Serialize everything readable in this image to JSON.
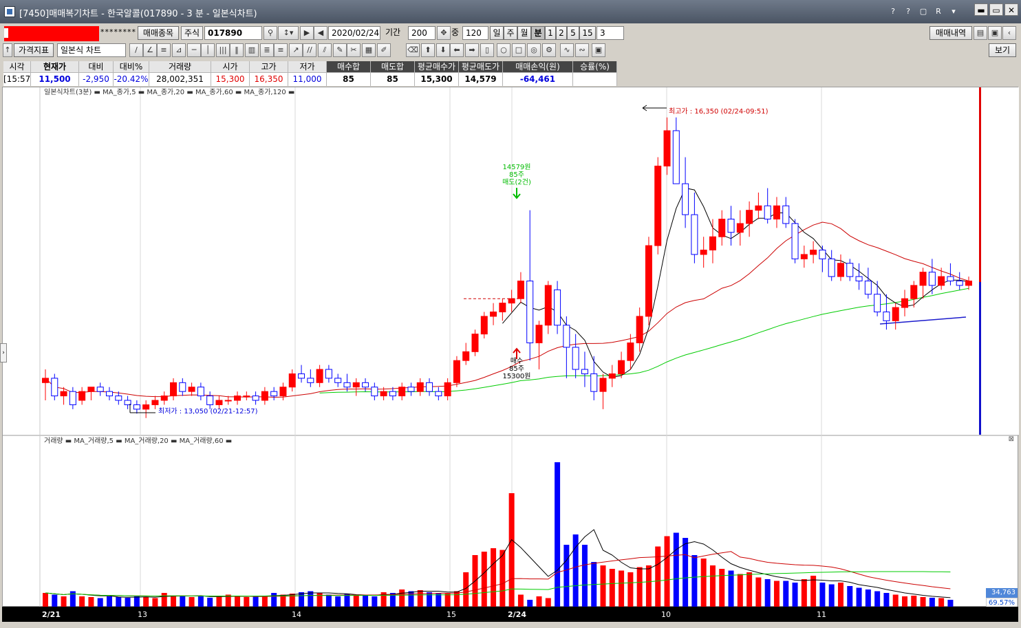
{
  "window": {
    "title": "[7450]매매복기차트 - 한국알콜(017890 - 3 분 - 일본식차트)",
    "icons": [
      "?",
      "?",
      "▢",
      "R",
      "▾"
    ],
    "win_buttons": [
      "▬",
      "▭",
      "✕"
    ]
  },
  "toolbar1": {
    "masked": "********",
    "trade_item_btn": "매매종목",
    "market": "주식",
    "code": "017890",
    "date": "2020/02/24",
    "period_label": "기간",
    "period": "200",
    "mid_label": "중",
    "count": "120",
    "periods": [
      "일",
      "주",
      "월",
      "분",
      "1",
      "2",
      "5",
      "15"
    ],
    "selected_period": "분",
    "interval": "3",
    "history_btn": "매매내역"
  },
  "toolbar2": {
    "indicator_btn": "가격지표",
    "chart_type": "일본식 차트",
    "view_btn": "보기"
  },
  "quote": {
    "headers": [
      "시각",
      "현재가",
      "대비",
      "대비%",
      "거래량",
      "시가",
      "고가",
      "저가",
      "매수합",
      "매도합",
      "평균매수가",
      "평균매도가",
      "매매손익(원)",
      "승률(%)"
    ],
    "values": [
      "[15:57]",
      "11,500",
      "-2,950",
      "-20.42%",
      "28,002,351",
      "15,300",
      "16,350",
      "11,000",
      "85",
      "85",
      "15,300",
      "14,579",
      "-64,461",
      ""
    ]
  },
  "chart": {
    "price_legend": "일본식차트(3분) ▬ MA_종가,5 ▬ MA_종가,20 ▬ MA_종가,60 ▬ MA_종가,120 ▬",
    "volume_legend": "거래량 ▬ MA_거래량,5 ▬ MA_거래량,20 ▬ MA_거래량,60 ▬",
    "high_label": "최고가 : 16,350 (02/24-09:51)",
    "low_label": "최저가 : 13,050 (02/21-12:57)",
    "sell_line1": "14579원",
    "sell_line2": "85주",
    "sell_line3": "매도(2건)",
    "buy_line1": "매수",
    "buy_line2": "85주",
    "buy_line3": "15300원",
    "vol_value": "34,763",
    "vol_pct": "69.57%",
    "dates": [
      "2/21",
      "13",
      "14",
      "15",
      "2/24",
      "10",
      "11"
    ]
  },
  "colors": {
    "up": "#ff0000",
    "down": "#0000ff",
    "ma5": "#000000",
    "ma20": "#cc0000",
    "ma60": "#00cc00",
    "ma120": "#1a1acc"
  },
  "chart_data": {
    "type": "candlestick",
    "candles": [
      [
        13350,
        13500,
        13150,
        13400
      ],
      [
        13400,
        13450,
        13150,
        13200
      ],
      [
        13200,
        13300,
        13100,
        13250
      ],
      [
        13250,
        13300,
        13050,
        13100
      ],
      [
        13150,
        13300,
        13100,
        13250
      ],
      [
        13250,
        13300,
        13150,
        13300
      ],
      [
        13300,
        13350,
        13200,
        13250
      ],
      [
        13250,
        13300,
        13150,
        13200
      ],
      [
        13200,
        13250,
        13100,
        13150
      ],
      [
        13150,
        13200,
        13050,
        13100
      ],
      [
        13100,
        13150,
        13000,
        13050
      ],
      [
        13050,
        13150,
        12950,
        13100
      ],
      [
        13100,
        13200,
        13050,
        13150
      ],
      [
        13150,
        13250,
        13100,
        13200
      ],
      [
        13200,
        13400,
        13150,
        13350
      ],
      [
        13350,
        13400,
        13200,
        13250
      ],
      [
        13250,
        13350,
        13200,
        13300
      ],
      [
        13300,
        13350,
        13150,
        13200
      ],
      [
        13200,
        13250,
        13050,
        13100
      ],
      [
        13100,
        13200,
        13050,
        13150
      ],
      [
        13150,
        13200,
        13100,
        13150
      ],
      [
        13150,
        13250,
        13100,
        13200
      ],
      [
        13200,
        13250,
        13150,
        13200
      ],
      [
        13200,
        13250,
        13100,
        13150
      ],
      [
        13150,
        13300,
        13100,
        13250
      ],
      [
        13250,
        13300,
        13150,
        13200
      ],
      [
        13200,
        13350,
        13150,
        13300
      ],
      [
        13300,
        13500,
        13250,
        13450
      ],
      [
        13450,
        13550,
        13350,
        13400
      ],
      [
        13400,
        13500,
        13300,
        13350
      ],
      [
        13350,
        13550,
        13300,
        13500
      ],
      [
        13500,
        13550,
        13350,
        13400
      ],
      [
        13400,
        13450,
        13300,
        13350
      ],
      [
        13350,
        13450,
        13250,
        13300
      ],
      [
        13300,
        13400,
        13200,
        13350
      ],
      [
        13350,
        13400,
        13250,
        13300
      ],
      [
        13300,
        13350,
        13150,
        13200
      ],
      [
        13200,
        13300,
        13150,
        13250
      ],
      [
        13250,
        13300,
        13150,
        13200
      ],
      [
        13200,
        13350,
        13150,
        13300
      ],
      [
        13300,
        13350,
        13200,
        13250
      ],
      [
        13250,
        13400,
        13200,
        13350
      ],
      [
        13350,
        13400,
        13200,
        13250
      ],
      [
        13250,
        13300,
        13150,
        13200
      ],
      [
        13200,
        13400,
        13150,
        13350
      ],
      [
        13350,
        13650,
        13300,
        13600
      ],
      [
        13600,
        13800,
        13550,
        13700
      ],
      [
        13700,
        13950,
        13650,
        13900
      ],
      [
        13900,
        14150,
        13850,
        14100
      ],
      [
        14100,
        14250,
        14000,
        14150
      ],
      [
        14150,
        14300,
        14050,
        14250
      ],
      [
        14250,
        14400,
        14150,
        14300
      ],
      [
        14300,
        14600,
        14250,
        14500
      ],
      [
        14500,
        15300,
        13600,
        13800
      ],
      [
        13800,
        14050,
        13500,
        14000
      ],
      [
        14000,
        14500,
        13900,
        14450
      ],
      [
        14400,
        14500,
        13900,
        14000
      ],
      [
        14000,
        14100,
        13400,
        13750
      ],
      [
        13750,
        13900,
        13400,
        13500
      ],
      [
        13500,
        13700,
        13300,
        13450
      ],
      [
        13450,
        13650,
        13150,
        13250
      ],
      [
        13250,
        13450,
        13050,
        13400
      ],
      [
        13400,
        13550,
        13300,
        13450
      ],
      [
        13450,
        13700,
        13400,
        13600
      ],
      [
        13600,
        13900,
        13500,
        13800
      ],
      [
        13800,
        14200,
        13700,
        14100
      ],
      [
        14100,
        15000,
        14000,
        14900
      ],
      [
        14900,
        15900,
        14800,
        15800
      ],
      [
        15800,
        16350,
        15700,
        16200
      ],
      [
        16200,
        16350,
        15600,
        15600
      ],
      [
        15600,
        15900,
        15100,
        15250
      ],
      [
        15250,
        15500,
        14700,
        14800
      ],
      [
        14800,
        15000,
        14650,
        14850
      ],
      [
        14850,
        15200,
        14700,
        15000
      ],
      [
        15000,
        15300,
        14900,
        15200
      ],
      [
        15200,
        15350,
        14900,
        15050
      ],
      [
        15050,
        15300,
        14900,
        15150
      ],
      [
        15150,
        15400,
        15000,
        15300
      ],
      [
        15300,
        15500,
        15200,
        15350
      ],
      [
        15350,
        15550,
        15150,
        15200
      ],
      [
        15200,
        15450,
        15100,
        15350
      ],
      [
        15350,
        15450,
        15100,
        15150
      ],
      [
        15150,
        15200,
        14700,
        14750
      ],
      [
        14750,
        14900,
        14650,
        14800
      ],
      [
        14800,
        14950,
        14700,
        14850
      ],
      [
        14850,
        14900,
        14600,
        14750
      ],
      [
        14750,
        14850,
        14500,
        14550
      ],
      [
        14550,
        14800,
        14500,
        14700
      ],
      [
        14700,
        14750,
        14500,
        14550
      ],
      [
        14550,
        14700,
        14400,
        14500
      ],
      [
        14500,
        14650,
        14300,
        14350
      ],
      [
        14350,
        14500,
        14100,
        14150
      ],
      [
        14150,
        14350,
        13950,
        14050
      ],
      [
        14050,
        14250,
        13950,
        14200
      ],
      [
        14200,
        14400,
        14100,
        14300
      ],
      [
        14300,
        14500,
        14200,
        14450
      ],
      [
        14450,
        14650,
        14300,
        14600
      ],
      [
        14600,
        14750,
        14350,
        14450
      ],
      [
        14450,
        14650,
        14400,
        14550
      ],
      [
        14550,
        14700,
        14450,
        14500
      ],
      [
        14500,
        14600,
        14400,
        14450
      ],
      [
        14450,
        14550,
        14400,
        14500
      ]
    ],
    "volumes": [
      40,
      35,
      30,
      45,
      30,
      28,
      25,
      30,
      28,
      26,
      30,
      28,
      25,
      40,
      30,
      32,
      28,
      30,
      26,
      30,
      35,
      30,
      28,
      30,
      32,
      40,
      35,
      38,
      42,
      45,
      40,
      35,
      30,
      38,
      32,
      35,
      30,
      42,
      40,
      50,
      45,
      48,
      42,
      40,
      38,
      45,
      100,
      150,
      160,
      170,
      165,
      330,
      35,
      20,
      30,
      25,
      420,
      180,
      210,
      180,
      130,
      120,
      110,
      105,
      100,
      115,
      120,
      175,
      205,
      215,
      200,
      150,
      140,
      120,
      110,
      105,
      95,
      100,
      85,
      80,
      75,
      75,
      70,
      80,
      90,
      70,
      65,
      70,
      60,
      55,
      50,
      45,
      40,
      35,
      30,
      32,
      28,
      26,
      25,
      20
    ]
  }
}
